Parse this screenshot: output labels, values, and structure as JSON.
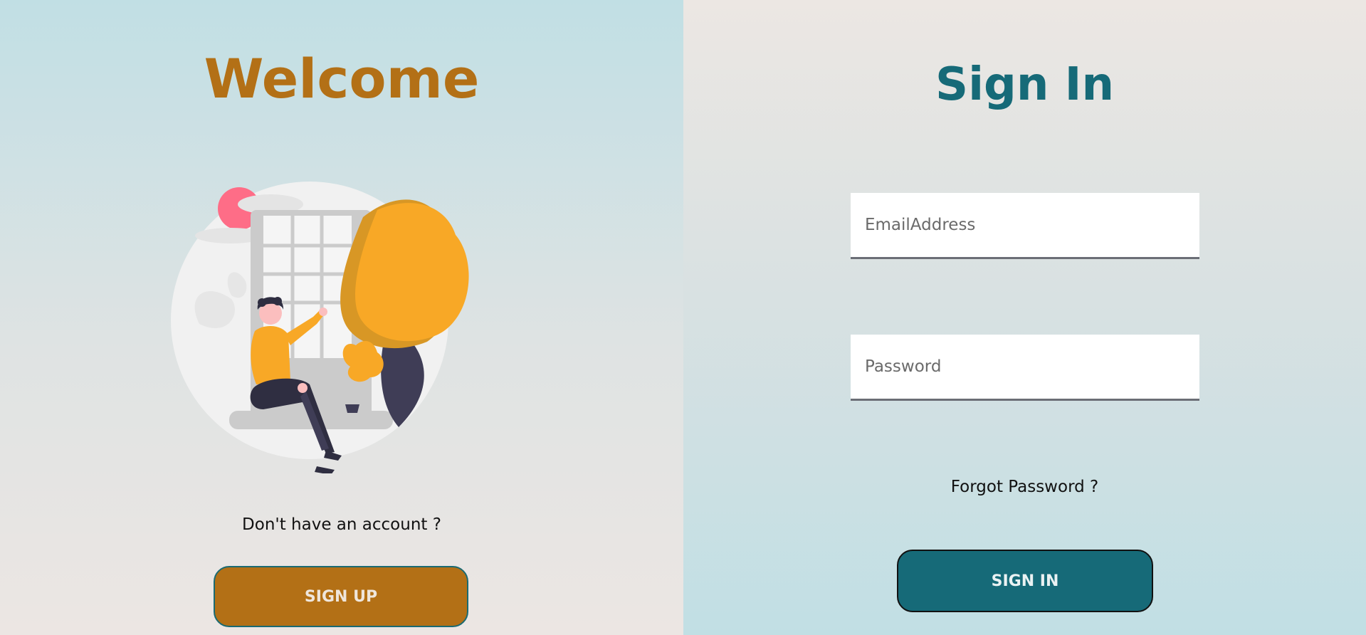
{
  "welcome": {
    "title": "Welcome",
    "no_account_text": "Don't have an account ?",
    "signup_label": "SIGN UP"
  },
  "signin": {
    "title": "Sign In",
    "email_placeholder": "EmailAddress",
    "password_placeholder": "Password",
    "forgot_label": "Forgot Password ?",
    "signin_label": "SIGN IN"
  },
  "colors": {
    "accent_gold": "#b37016",
    "accent_teal": "#166a78",
    "tree_orange": "#f8a826",
    "sun_pink": "#fe6d87"
  },
  "illustration": {
    "icon": "woman-at-window-illustration"
  }
}
